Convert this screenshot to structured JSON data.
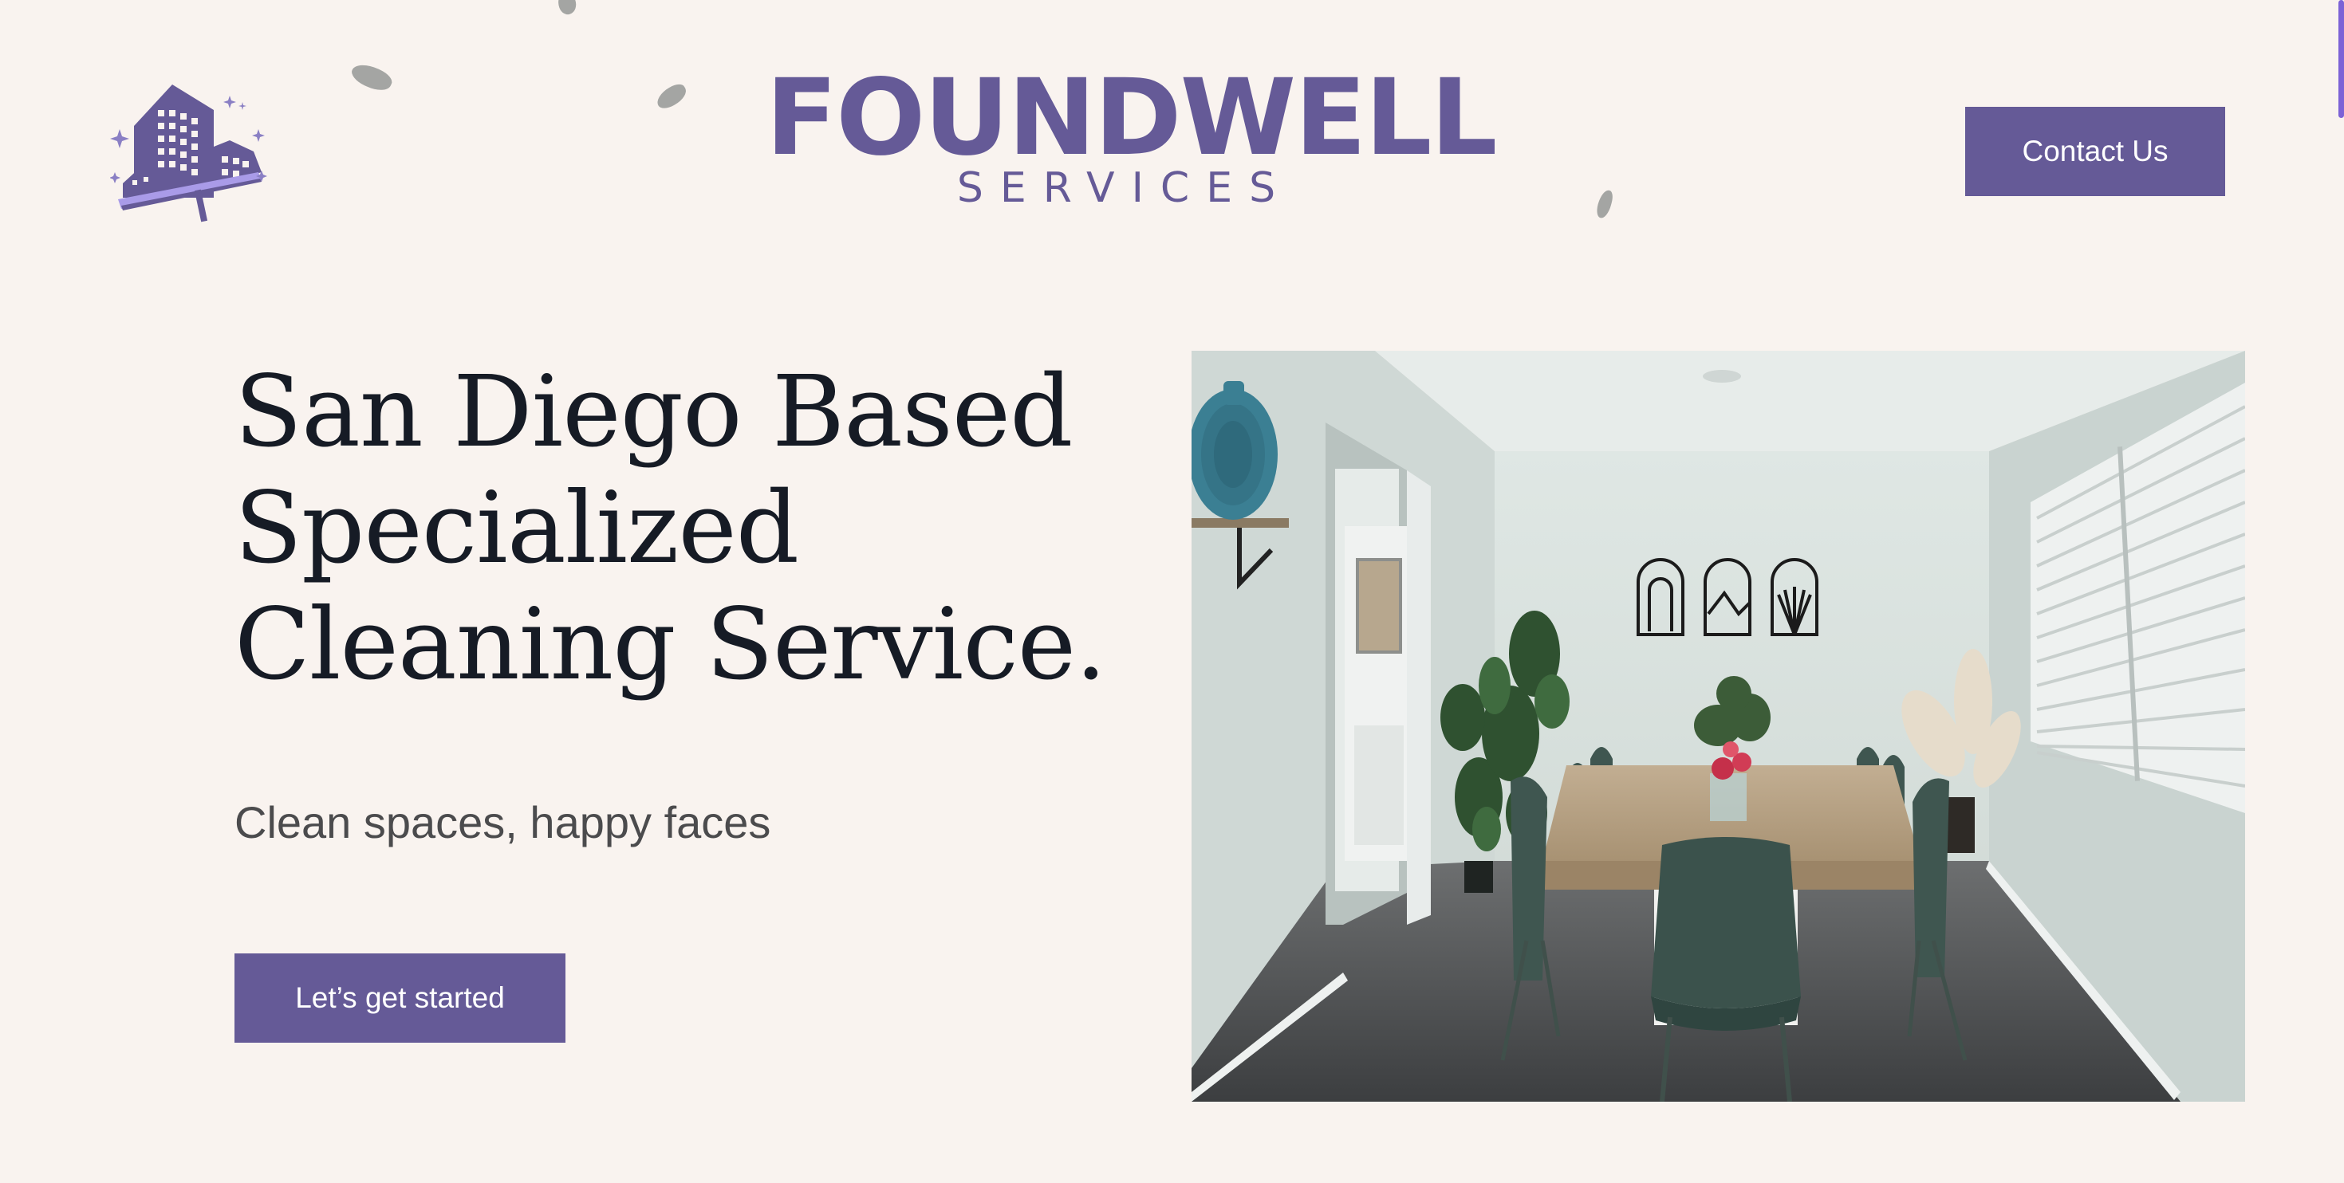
{
  "header": {
    "brand_name": "FOUNDWELL",
    "brand_sub": "SERVICES",
    "logo_icon": "building-squeegee-icon",
    "contact_label": "Contact Us"
  },
  "hero": {
    "title_lines": [
      "San Diego Based",
      "Specialized",
      "Cleaning Service."
    ],
    "tagline": "Clean spaces, happy faces",
    "cta_label": "Let’s get started",
    "image": "dining-room-photo"
  },
  "colors": {
    "background": "#f9f3ef",
    "brand_purple": "#655a97",
    "heading": "#161b25",
    "accent": "#7c62d6"
  }
}
